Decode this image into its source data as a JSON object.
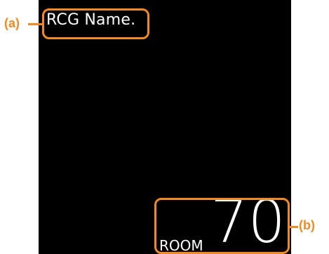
{
  "colors": {
    "screen_background": "#000000",
    "screen_text": "#ffffff",
    "callout": "#f08a24"
  },
  "display": {
    "rcg_name": "RCG Name.",
    "room_label": "ROOM",
    "room_number": "70"
  },
  "callouts": {
    "a_label": "(a)",
    "b_label": "(b)"
  }
}
